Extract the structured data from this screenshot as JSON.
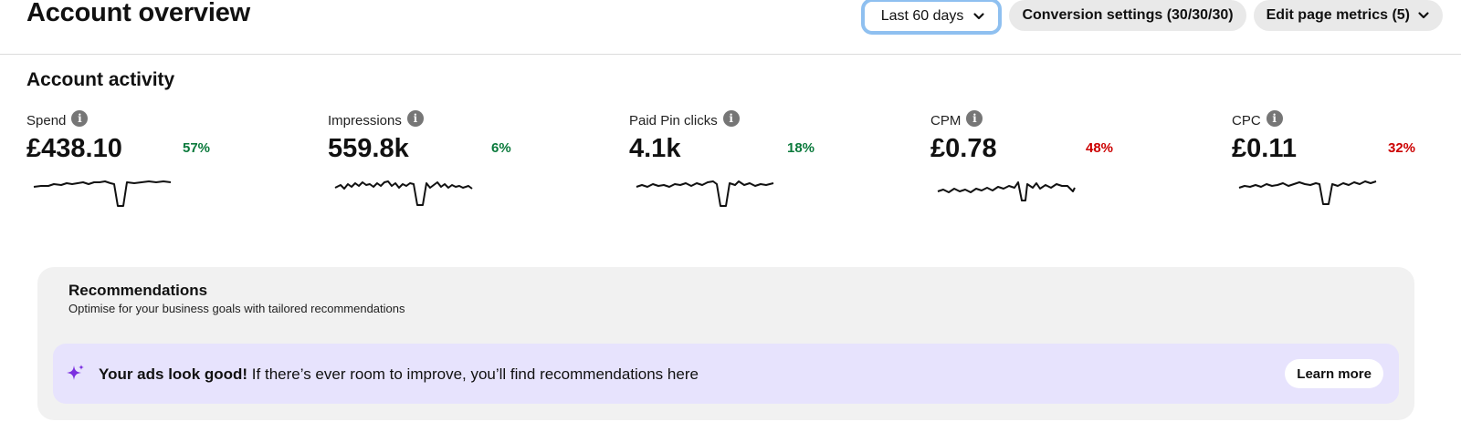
{
  "header": {
    "title": "Account overview",
    "date_range": "Last 60 days",
    "conversion_settings": "Conversion settings (30/30/30)",
    "edit_metrics": "Edit page metrics (5)"
  },
  "activity": {
    "title": "Account activity",
    "metrics": [
      {
        "label": "Spend",
        "value": "£438.10",
        "change": "57%",
        "trend": "up"
      },
      {
        "label": "Impressions",
        "value": "559.8k",
        "change": "6%",
        "trend": "up"
      },
      {
        "label": "Paid Pin clicks",
        "value": "4.1k",
        "change": "18%",
        "trend": "up"
      },
      {
        "label": "CPM",
        "value": "£0.78",
        "change": "48%",
        "trend": "down"
      },
      {
        "label": "CPC",
        "value": "£0.11",
        "change": "32%",
        "trend": "down"
      }
    ]
  },
  "recommendations": {
    "title": "Recommendations",
    "subtitle": "Optimise for your business goals with tailored recommendations",
    "banner_bold": "Your ads look good!",
    "banner_text": " If there’s ever room to improve, you’ll find recommendations here",
    "learn_more": "Learn more"
  },
  "colors": {
    "positive": "#0b7a3c",
    "negative": "#cc0000",
    "banner_bg": "#e7e3fd",
    "panel_bg": "#f1f1f1",
    "sparkle": "#7b2fe0"
  },
  "icons": {
    "info": "info-icon",
    "chevron": "chevron-down-icon",
    "sparkle": "sparkle-icon"
  }
}
